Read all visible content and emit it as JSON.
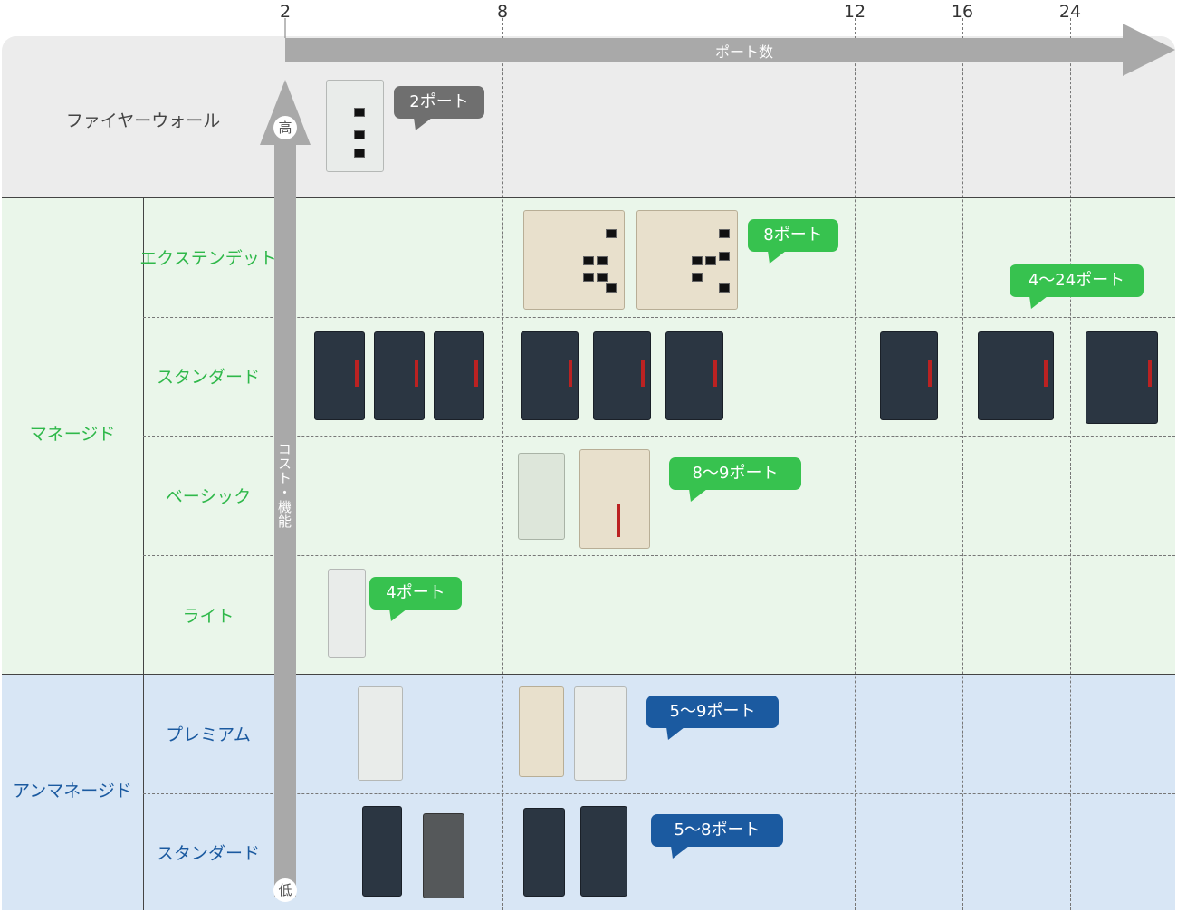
{
  "axis": {
    "x_title": "ポート数",
    "ticks": [
      "2",
      "8",
      "12",
      "16",
      "24"
    ],
    "y_title": "コスト・機能",
    "y_high": "高",
    "y_low": "低"
  },
  "groups": {
    "firewall": "ファイヤーウォール",
    "managed": "マネージド",
    "unmanaged": "アンマネージド"
  },
  "rows": {
    "extended": "エクステンデット",
    "standard_managed": "スタンダード",
    "basic": "ベーシック",
    "lite": "ライト",
    "premium": "プレミアム",
    "standard_unmanaged": "スタンダード"
  },
  "bubbles": {
    "firewall": "2ポート",
    "extended": "8ポート",
    "standard_managed": "4～24ポート",
    "basic": "8～9ポート",
    "lite": "4ポート",
    "premium": "5～9ポート",
    "standard_unmanaged": "5～8ポート"
  },
  "colors": {
    "firewall_band": "#ececec",
    "managed_band": "#eaf6ea",
    "unmanaged_band": "#d8e6f5",
    "gray_bubble": "#6f6f6f",
    "green_bubble": "#37c24f",
    "blue_bubble": "#1b5aa0"
  }
}
